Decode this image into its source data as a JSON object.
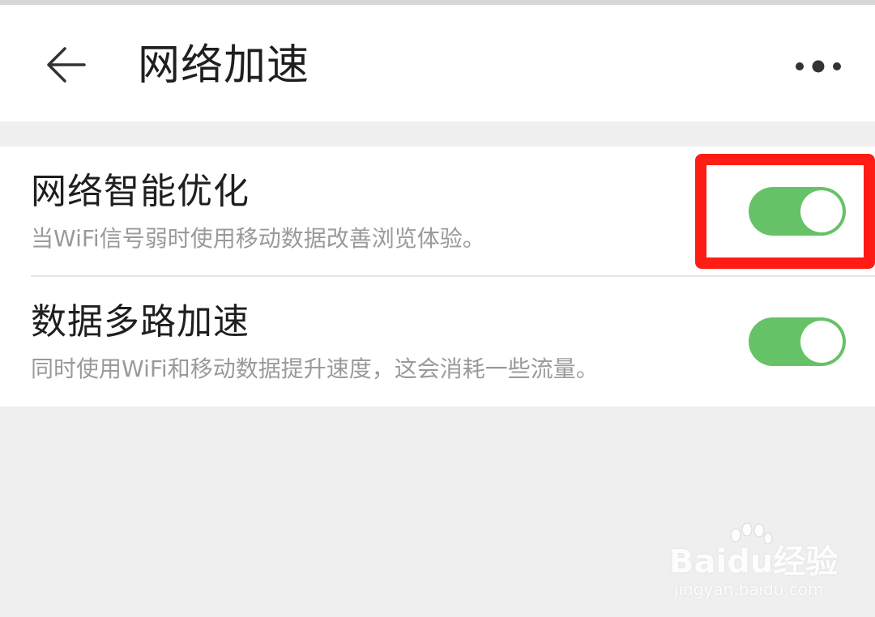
{
  "app_bar": {
    "title": "网络加速",
    "back_icon": "back-arrow-icon",
    "more_icon": "more-dots-icon"
  },
  "settings": [
    {
      "title": "网络智能优化",
      "description": "当WiFi信号弱时使用移动数据改善浏览体验。",
      "enabled": true
    },
    {
      "title": "数据多路加速",
      "description": "同时使用WiFi和移动数据提升速度，这会消耗一些流量。",
      "enabled": true
    }
  ],
  "watermark": {
    "logo": "Baidu经验",
    "url": "jingyan.baidu.com"
  },
  "colors": {
    "toggle_on": "#66c266",
    "highlight": "#ff1c14",
    "background": "#efefef"
  }
}
